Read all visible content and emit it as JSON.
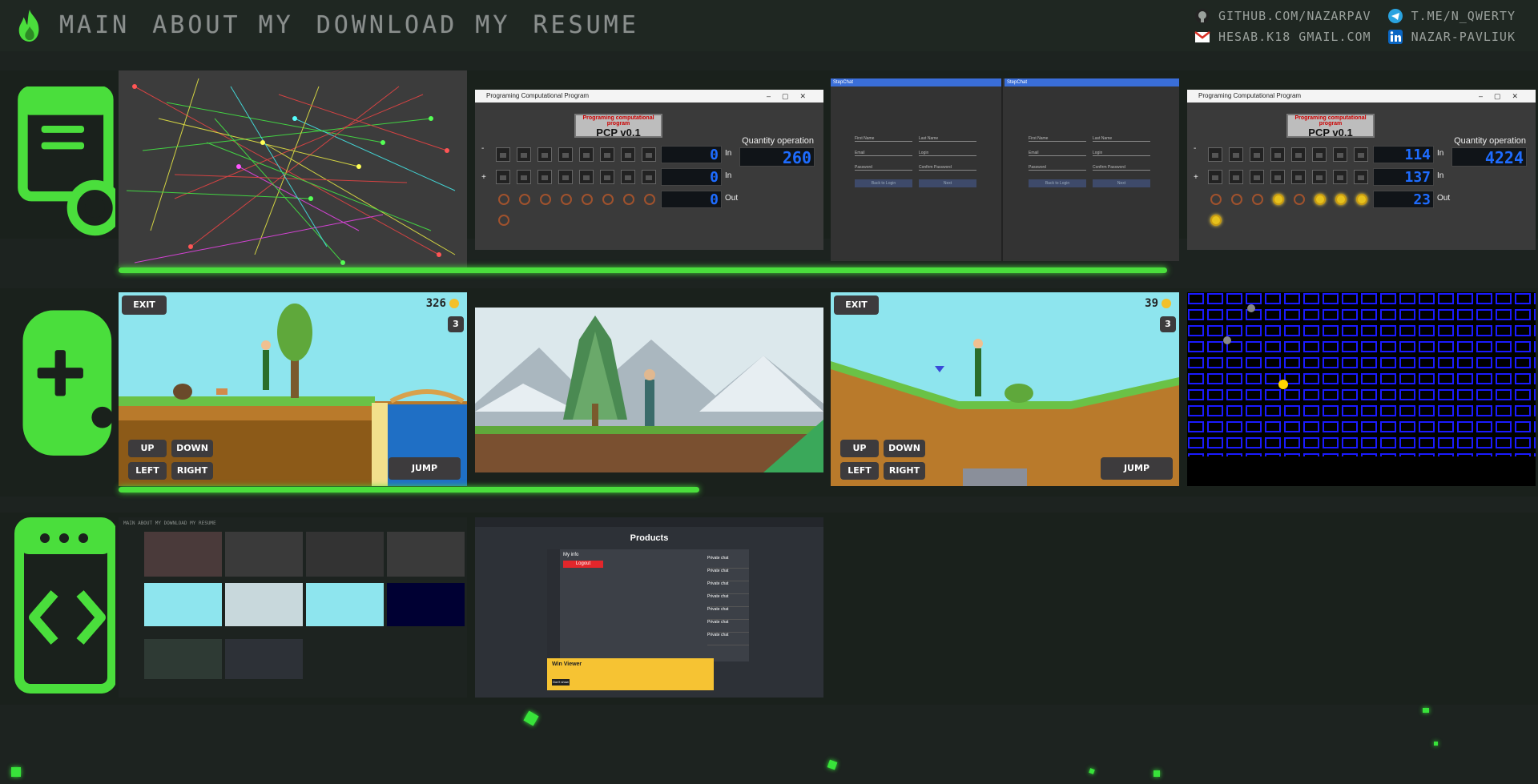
{
  "nav": {
    "items": [
      "MAIN",
      "ABOUT MY",
      "DOWNLOAD MY",
      "RESUME"
    ]
  },
  "contacts": {
    "github": "GITHUB.COM/NAZARPAV",
    "telegram": "T.ME/N_QWERTY",
    "email": "HESAB.K18 GMAIL.COM",
    "linkedin": "NAZAR-PAVLIUK"
  },
  "icons": {
    "logo": "flame-icon",
    "github": "github-icon",
    "telegram": "telegram-icon",
    "email": "gmail-icon",
    "linkedin": "linkedin-icon",
    "section1": "app-settings-icon",
    "section2": "gamepad-icon",
    "section3": "code-window-icon"
  },
  "colors": {
    "accent": "#4ade3c",
    "background": "#1a211c"
  },
  "program": {
    "window_title": "Programing Computational Program",
    "banner_red": "Programing computational program",
    "banner": "PCP v0.1",
    "quantity_label": "Quantity operation",
    "in_label": "In",
    "out_label": "Out",
    "minus": "-",
    "plus": "+",
    "first": {
      "quantity": "260",
      "in1": "0",
      "in2": "0",
      "out": "0"
    },
    "second": {
      "quantity": "4224",
      "in1": "114",
      "in2": "137",
      "out": "23"
    }
  },
  "chat": {
    "title": "StepChat",
    "fields": [
      "First Name",
      "Last Name",
      "Email",
      "Login",
      "Password",
      "Confirm Password"
    ],
    "back_button": "Back to Login",
    "next_button": "Next"
  },
  "games": {
    "exit_label": "EXIT",
    "up_label": "UP",
    "down_label": "DOWN",
    "left_label": "LEFT",
    "right_label": "RIGHT",
    "jump_label": "JUMP",
    "score1": "326",
    "score2": "39",
    "level1": "3",
    "level2": "3"
  },
  "web": {
    "page_title": "Products",
    "menu_my_info": "My info",
    "menu_logout": "Logout",
    "private_chat": "Private chat",
    "banner_title": "Win Viewer",
    "banner_button": "Don't show"
  },
  "progress": {
    "section1": 0.74,
    "section2": 0.41
  }
}
